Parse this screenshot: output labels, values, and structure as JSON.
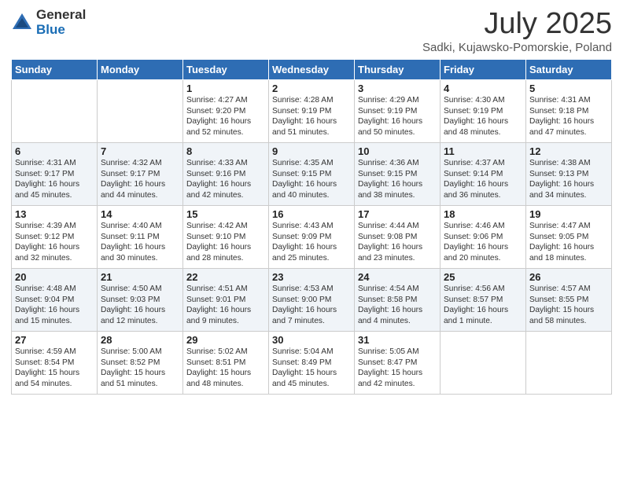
{
  "logo": {
    "general": "General",
    "blue": "Blue"
  },
  "header": {
    "month": "July 2025",
    "location": "Sadki, Kujawsko-Pomorskie, Poland"
  },
  "days_of_week": [
    "Sunday",
    "Monday",
    "Tuesday",
    "Wednesday",
    "Thursday",
    "Friday",
    "Saturday"
  ],
  "weeks": [
    [
      {
        "day": "",
        "content": ""
      },
      {
        "day": "",
        "content": ""
      },
      {
        "day": "1",
        "content": "Sunrise: 4:27 AM\nSunset: 9:20 PM\nDaylight: 16 hours and 52 minutes."
      },
      {
        "day": "2",
        "content": "Sunrise: 4:28 AM\nSunset: 9:19 PM\nDaylight: 16 hours and 51 minutes."
      },
      {
        "day": "3",
        "content": "Sunrise: 4:29 AM\nSunset: 9:19 PM\nDaylight: 16 hours and 50 minutes."
      },
      {
        "day": "4",
        "content": "Sunrise: 4:30 AM\nSunset: 9:19 PM\nDaylight: 16 hours and 48 minutes."
      },
      {
        "day": "5",
        "content": "Sunrise: 4:31 AM\nSunset: 9:18 PM\nDaylight: 16 hours and 47 minutes."
      }
    ],
    [
      {
        "day": "6",
        "content": "Sunrise: 4:31 AM\nSunset: 9:17 PM\nDaylight: 16 hours and 45 minutes."
      },
      {
        "day": "7",
        "content": "Sunrise: 4:32 AM\nSunset: 9:17 PM\nDaylight: 16 hours and 44 minutes."
      },
      {
        "day": "8",
        "content": "Sunrise: 4:33 AM\nSunset: 9:16 PM\nDaylight: 16 hours and 42 minutes."
      },
      {
        "day": "9",
        "content": "Sunrise: 4:35 AM\nSunset: 9:15 PM\nDaylight: 16 hours and 40 minutes."
      },
      {
        "day": "10",
        "content": "Sunrise: 4:36 AM\nSunset: 9:15 PM\nDaylight: 16 hours and 38 minutes."
      },
      {
        "day": "11",
        "content": "Sunrise: 4:37 AM\nSunset: 9:14 PM\nDaylight: 16 hours and 36 minutes."
      },
      {
        "day": "12",
        "content": "Sunrise: 4:38 AM\nSunset: 9:13 PM\nDaylight: 16 hours and 34 minutes."
      }
    ],
    [
      {
        "day": "13",
        "content": "Sunrise: 4:39 AM\nSunset: 9:12 PM\nDaylight: 16 hours and 32 minutes."
      },
      {
        "day": "14",
        "content": "Sunrise: 4:40 AM\nSunset: 9:11 PM\nDaylight: 16 hours and 30 minutes."
      },
      {
        "day": "15",
        "content": "Sunrise: 4:42 AM\nSunset: 9:10 PM\nDaylight: 16 hours and 28 minutes."
      },
      {
        "day": "16",
        "content": "Sunrise: 4:43 AM\nSunset: 9:09 PM\nDaylight: 16 hours and 25 minutes."
      },
      {
        "day": "17",
        "content": "Sunrise: 4:44 AM\nSunset: 9:08 PM\nDaylight: 16 hours and 23 minutes."
      },
      {
        "day": "18",
        "content": "Sunrise: 4:46 AM\nSunset: 9:06 PM\nDaylight: 16 hours and 20 minutes."
      },
      {
        "day": "19",
        "content": "Sunrise: 4:47 AM\nSunset: 9:05 PM\nDaylight: 16 hours and 18 minutes."
      }
    ],
    [
      {
        "day": "20",
        "content": "Sunrise: 4:48 AM\nSunset: 9:04 PM\nDaylight: 16 hours and 15 minutes."
      },
      {
        "day": "21",
        "content": "Sunrise: 4:50 AM\nSunset: 9:03 PM\nDaylight: 16 hours and 12 minutes."
      },
      {
        "day": "22",
        "content": "Sunrise: 4:51 AM\nSunset: 9:01 PM\nDaylight: 16 hours and 9 minutes."
      },
      {
        "day": "23",
        "content": "Sunrise: 4:53 AM\nSunset: 9:00 PM\nDaylight: 16 hours and 7 minutes."
      },
      {
        "day": "24",
        "content": "Sunrise: 4:54 AM\nSunset: 8:58 PM\nDaylight: 16 hours and 4 minutes."
      },
      {
        "day": "25",
        "content": "Sunrise: 4:56 AM\nSunset: 8:57 PM\nDaylight: 16 hours and 1 minute."
      },
      {
        "day": "26",
        "content": "Sunrise: 4:57 AM\nSunset: 8:55 PM\nDaylight: 15 hours and 58 minutes."
      }
    ],
    [
      {
        "day": "27",
        "content": "Sunrise: 4:59 AM\nSunset: 8:54 PM\nDaylight: 15 hours and 54 minutes."
      },
      {
        "day": "28",
        "content": "Sunrise: 5:00 AM\nSunset: 8:52 PM\nDaylight: 15 hours and 51 minutes."
      },
      {
        "day": "29",
        "content": "Sunrise: 5:02 AM\nSunset: 8:51 PM\nDaylight: 15 hours and 48 minutes."
      },
      {
        "day": "30",
        "content": "Sunrise: 5:04 AM\nSunset: 8:49 PM\nDaylight: 15 hours and 45 minutes."
      },
      {
        "day": "31",
        "content": "Sunrise: 5:05 AM\nSunset: 8:47 PM\nDaylight: 15 hours and 42 minutes."
      },
      {
        "day": "",
        "content": ""
      },
      {
        "day": "",
        "content": ""
      }
    ]
  ]
}
